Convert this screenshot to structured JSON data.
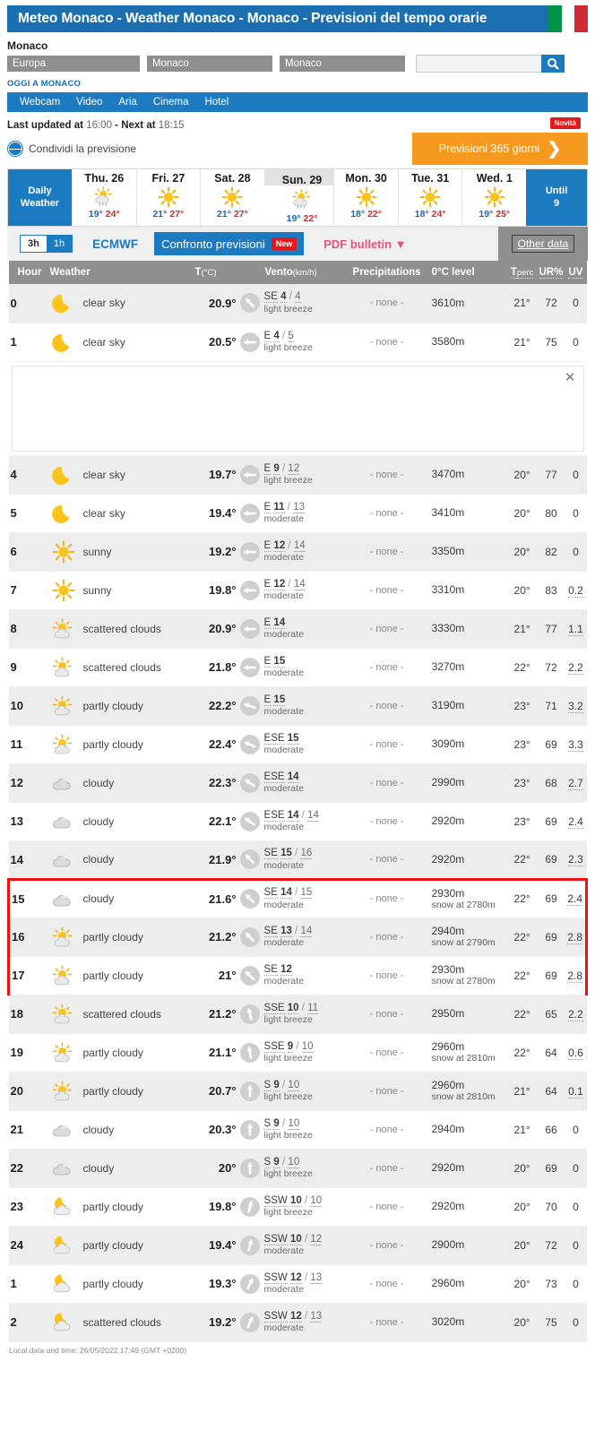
{
  "header": {
    "title": "Meteo Monaco - Weather Monaco - Monaco - Previsioni del tempo orarie",
    "flag": "italy-flag"
  },
  "location": {
    "name": "Monaco",
    "continent": "Europa",
    "country": "Monaco",
    "city": "Monaco",
    "search_value": "",
    "search_placeholder": ""
  },
  "today_label": "OGGI A MONACO",
  "nav": {
    "items": [
      "Webcam",
      "Video",
      "Aria",
      "Cinema",
      "Hotel"
    ]
  },
  "update": {
    "prefix": "Last updated at",
    "last": "16:00",
    "middle": "- Next at",
    "next": "18:15",
    "share": "Condividi la previsione"
  },
  "promo": {
    "label": "Previsioni 365 giorni",
    "badge": "Novità",
    "chevron": "❯"
  },
  "daystrip": {
    "first_label_line1": "Daily",
    "first_label_line2": "Weather",
    "last_label_line1": "Until",
    "last_label_line2": "9",
    "days": [
      {
        "name": "Thu. 26",
        "icon": "sun-cloud-rain-icon",
        "min": "19°",
        "max": "24°",
        "selected": false
      },
      {
        "name": "Fri. 27",
        "icon": "sun-icon",
        "min": "21°",
        "max": "27°",
        "selected": false
      },
      {
        "name": "Sat. 28",
        "icon": "sun-icon",
        "min": "21°",
        "max": "27°",
        "selected": false
      },
      {
        "name": "Sun. 29",
        "icon": "sun-cloud-rain-icon",
        "min": "19°",
        "max": "22°",
        "selected": true
      },
      {
        "name": "Mon. 30",
        "icon": "sun-icon",
        "min": "18°",
        "max": "22°",
        "selected": false
      },
      {
        "name": "Tue. 31",
        "icon": "sun-icon",
        "min": "18°",
        "max": "24°",
        "selected": false
      },
      {
        "name": "Wed. 1",
        "icon": "sun-icon",
        "min": "19°",
        "max": "25°",
        "selected": false
      }
    ]
  },
  "options": {
    "toggle_3h": "3h",
    "toggle_1h": "1h",
    "model": "ECMWF",
    "compare": "Confronto previsioni",
    "compare_badge": "New",
    "pdf": "PDF bulletin ▼",
    "other_data": "Other data"
  },
  "table": {
    "headers": {
      "hour": "Hour",
      "weather": "Weather",
      "t_main": "T",
      "t_sub": "(°C)",
      "wind_main": "Vento",
      "wind_sub": "(km/h)",
      "precipitations": "Precipitations",
      "zero_level": "0°C level",
      "tperc_main": "T",
      "tperc_sub": "perc",
      "ur": "UR%",
      "uv": "UV"
    },
    "rows": [
      {
        "hour": "0",
        "icon": "moon-icon",
        "weather": "clear sky",
        "temp": "20.9°",
        "wind_dir": "SE",
        "wind_speed": "4",
        "wind_gust": "4",
        "wind_desc": "light breeze",
        "wind_angle": 315,
        "prec": "- none -",
        "level": "3610m",
        "snow": "",
        "tperc": "21°",
        "ur": "72",
        "uv": "0",
        "uv_dotted": false
      },
      {
        "hour": "1",
        "icon": "moon-icon",
        "weather": "clear sky",
        "temp": "20.5°",
        "wind_dir": "E",
        "wind_speed": "4",
        "wind_gust": "5",
        "wind_desc": "light breeze",
        "wind_angle": 270,
        "prec": "- none -",
        "level": "3580m",
        "snow": "",
        "tperc": "21°",
        "ur": "75",
        "uv": "0",
        "uv_dotted": false
      },
      {
        "ad": true,
        "close": "✕"
      },
      {
        "hour": "4",
        "icon": "moon-icon",
        "weather": "clear sky",
        "temp": "19.7°",
        "wind_dir": "E",
        "wind_speed": "9",
        "wind_gust": "12",
        "wind_desc": "light breeze",
        "wind_angle": 270,
        "prec": "- none -",
        "level": "3470m",
        "snow": "",
        "tperc": "20°",
        "ur": "77",
        "uv": "0",
        "uv_dotted": false
      },
      {
        "hour": "5",
        "icon": "moon-icon",
        "weather": "clear sky",
        "temp": "19.4°",
        "wind_dir": "E",
        "wind_speed": "11",
        "wind_gust": "13",
        "wind_desc": "moderate",
        "wind_angle": 270,
        "prec": "- none -",
        "level": "3410m",
        "snow": "",
        "tperc": "20°",
        "ur": "80",
        "uv": "0",
        "uv_dotted": false
      },
      {
        "hour": "6",
        "icon": "sun-icon",
        "weather": "sunny",
        "temp": "19.2°",
        "wind_dir": "E",
        "wind_speed": "12",
        "wind_gust": "14",
        "wind_desc": "moderate",
        "wind_angle": 270,
        "prec": "- none -",
        "level": "3350m",
        "snow": "",
        "tperc": "20°",
        "ur": "82",
        "uv": "0",
        "uv_dotted": false
      },
      {
        "hour": "7",
        "icon": "sun-icon",
        "weather": "sunny",
        "temp": "19.8°",
        "wind_dir": "E",
        "wind_speed": "12",
        "wind_gust": "14",
        "wind_desc": "moderate",
        "wind_angle": 270,
        "prec": "- none -",
        "level": "3310m",
        "snow": "",
        "tperc": "20°",
        "ur": "83",
        "uv": "0.2",
        "uv_dotted": true
      },
      {
        "hour": "8",
        "icon": "sun-cloud-icon",
        "weather": "scattered clouds",
        "temp": "20.9°",
        "wind_dir": "E",
        "wind_speed": "14",
        "wind_gust": "",
        "wind_desc": "moderate",
        "wind_angle": 270,
        "prec": "- none -",
        "level": "3330m",
        "snow": "",
        "tperc": "21°",
        "ur": "77",
        "uv": "1.1",
        "uv_dotted": true
      },
      {
        "hour": "9",
        "icon": "sun-cloud-icon",
        "weather": "scattered clouds",
        "temp": "21.8°",
        "wind_dir": "E",
        "wind_speed": "15",
        "wind_gust": "",
        "wind_desc": "moderate",
        "wind_angle": 270,
        "prec": "- none -",
        "level": "3270m",
        "snow": "",
        "tperc": "22°",
        "ur": "72",
        "uv": "2.2",
        "uv_dotted": true
      },
      {
        "hour": "10",
        "icon": "sun-cloud-icon",
        "weather": "partly cloudy",
        "temp": "22.2°",
        "wind_dir": "E",
        "wind_speed": "15",
        "wind_gust": "",
        "wind_desc": "moderate",
        "wind_angle": 290,
        "prec": "- none -",
        "level": "3190m",
        "snow": "",
        "tperc": "23°",
        "ur": "71",
        "uv": "3.2",
        "uv_dotted": true
      },
      {
        "hour": "11",
        "icon": "sun-cloud-icon",
        "weather": "partly cloudy",
        "temp": "22.4°",
        "wind_dir": "ESE",
        "wind_speed": "15",
        "wind_gust": "",
        "wind_desc": "moderate",
        "wind_angle": 295,
        "prec": "- none -",
        "level": "3090m",
        "snow": "",
        "tperc": "23°",
        "ur": "69",
        "uv": "3.3",
        "uv_dotted": true
      },
      {
        "hour": "12",
        "icon": "cloud-icon",
        "weather": "cloudy",
        "temp": "22.3°",
        "wind_dir": "ESE",
        "wind_speed": "14",
        "wind_gust": "",
        "wind_desc": "moderate",
        "wind_angle": 305,
        "prec": "- none -",
        "level": "2990m",
        "snow": "",
        "tperc": "23°",
        "ur": "68",
        "uv": "2.7",
        "uv_dotted": true
      },
      {
        "hour": "13",
        "icon": "cloud-icon",
        "weather": "cloudy",
        "temp": "22.1°",
        "wind_dir": "ESE",
        "wind_speed": "14",
        "wind_gust": "14",
        "wind_desc": "moderate",
        "wind_angle": 305,
        "prec": "- none -",
        "level": "2920m",
        "snow": "",
        "tperc": "23°",
        "ur": "69",
        "uv": "2.4",
        "uv_dotted": true
      },
      {
        "hour": "14",
        "icon": "cloud-icon",
        "weather": "cloudy",
        "temp": "21.9°",
        "wind_dir": "SE",
        "wind_speed": "15",
        "wind_gust": "16",
        "wind_desc": "moderate",
        "wind_angle": 315,
        "prec": "- none -",
        "level": "2920m",
        "snow": "",
        "tperc": "22°",
        "ur": "69",
        "uv": "2.3",
        "uv_dotted": true
      },
      {
        "hour": "15",
        "icon": "cloud-icon",
        "weather": "cloudy",
        "temp": "21.6°",
        "wind_dir": "SE",
        "wind_speed": "14",
        "wind_gust": "15",
        "wind_desc": "moderate",
        "wind_angle": 315,
        "prec": "- none -",
        "level": "2930m",
        "snow": "snow at 2780m",
        "tperc": "22°",
        "ur": "69",
        "uv": "2.4",
        "uv_dotted": true,
        "highlight": "top"
      },
      {
        "hour": "16",
        "icon": "sun-cloud-icon",
        "weather": "partly cloudy",
        "temp": "21.2°",
        "wind_dir": "SE",
        "wind_speed": "13",
        "wind_gust": "14",
        "wind_desc": "moderate",
        "wind_angle": 315,
        "prec": "- none -",
        "level": "2940m",
        "snow": "snow at 2790m",
        "tperc": "22°",
        "ur": "69",
        "uv": "2.8",
        "uv_dotted": true,
        "highlight": "mid"
      },
      {
        "hour": "17",
        "icon": "sun-cloud-icon",
        "weather": "partly cloudy",
        "temp": "21°",
        "wind_dir": "SE",
        "wind_speed": "12",
        "wind_gust": "",
        "wind_desc": "moderate",
        "wind_angle": 315,
        "prec": "- none -",
        "level": "2930m",
        "snow": "snow at 2780m",
        "tperc": "22°",
        "ur": "69",
        "uv": "2.8",
        "uv_dotted": true,
        "highlight": "bot"
      },
      {
        "hour": "18",
        "icon": "sun-cloud-icon",
        "weather": "scattered clouds",
        "temp": "21.2°",
        "wind_dir": "SSE",
        "wind_speed": "10",
        "wind_gust": "11",
        "wind_desc": "light breeze",
        "wind_angle": 345,
        "prec": "- none -",
        "level": "2950m",
        "snow": "",
        "tperc": "22°",
        "ur": "65",
        "uv": "2.2",
        "uv_dotted": true
      },
      {
        "hour": "19",
        "icon": "sun-cloud-icon",
        "weather": "partly cloudy",
        "temp": "21.1°",
        "wind_dir": "SSE",
        "wind_speed": "9",
        "wind_gust": "10",
        "wind_desc": "light breeze",
        "wind_angle": 350,
        "prec": "- none -",
        "level": "2960m",
        "snow": "snow at 2810m",
        "tperc": "22°",
        "ur": "64",
        "uv": "0.6",
        "uv_dotted": true
      },
      {
        "hour": "20",
        "icon": "sun-cloud-icon",
        "weather": "partly cloudy",
        "temp": "20.7°",
        "wind_dir": "S",
        "wind_speed": "9",
        "wind_gust": "10",
        "wind_desc": "light breeze",
        "wind_angle": 0,
        "prec": "- none -",
        "level": "2960m",
        "snow": "snow at 2810m",
        "tperc": "21°",
        "ur": "64",
        "uv": "0.1",
        "uv_dotted": true
      },
      {
        "hour": "21",
        "icon": "cloud-icon",
        "weather": "cloudy",
        "temp": "20.3°",
        "wind_dir": "S",
        "wind_speed": "9",
        "wind_gust": "10",
        "wind_desc": "light breeze",
        "wind_angle": 0,
        "prec": "- none -",
        "level": "2940m",
        "snow": "",
        "tperc": "21°",
        "ur": "66",
        "uv": "0",
        "uv_dotted": false
      },
      {
        "hour": "22",
        "icon": "cloud-icon",
        "weather": "cloudy",
        "temp": "20°",
        "wind_dir": "S",
        "wind_speed": "9",
        "wind_gust": "10",
        "wind_desc": "light breeze",
        "wind_angle": 0,
        "prec": "- none -",
        "level": "2920m",
        "snow": "",
        "tperc": "20°",
        "ur": "69",
        "uv": "0",
        "uv_dotted": false
      },
      {
        "hour": "23",
        "icon": "moon-cloud-icon",
        "weather": "partly cloudy",
        "temp": "19.8°",
        "wind_dir": "SSW",
        "wind_speed": "10",
        "wind_gust": "10",
        "wind_desc": "light breeze",
        "wind_angle": 15,
        "prec": "- none -",
        "level": "2920m",
        "snow": "",
        "tperc": "20°",
        "ur": "70",
        "uv": "0",
        "uv_dotted": false
      },
      {
        "hour": "24",
        "icon": "moon-cloud-icon",
        "weather": "partly cloudy",
        "temp": "19.4°",
        "wind_dir": "SSW",
        "wind_speed": "10",
        "wind_gust": "12",
        "wind_desc": "moderate",
        "wind_angle": 15,
        "prec": "- none -",
        "level": "2900m",
        "snow": "",
        "tperc": "20°",
        "ur": "72",
        "uv": "0",
        "uv_dotted": false
      },
      {
        "hour": "1",
        "icon": "moon-cloud-icon",
        "weather": "partly cloudy",
        "temp": "19.3°",
        "wind_dir": "SSW",
        "wind_speed": "12",
        "wind_gust": "13",
        "wind_desc": "moderate",
        "wind_angle": 25,
        "prec": "- none -",
        "level": "2960m",
        "snow": "",
        "tperc": "20°",
        "ur": "73",
        "uv": "0",
        "uv_dotted": false
      },
      {
        "hour": "2",
        "icon": "moon-cloud-icon",
        "weather": "scattered clouds",
        "temp": "19.2°",
        "wind_dir": "SSW",
        "wind_speed": "12",
        "wind_gust": "13",
        "wind_desc": "moderate",
        "wind_angle": 25,
        "prec": "- none -",
        "level": "3020m",
        "snow": "",
        "tperc": "20°",
        "ur": "75",
        "uv": "0",
        "uv_dotted": false
      }
    ]
  },
  "footer": {
    "local_time": "Local data and time: 26/05/2022 17:49 (GMT +0200)"
  },
  "colors": {
    "brand_blue": "#1b7ac0",
    "title_blue": "#1b6fb0",
    "orange": "#f59a1e",
    "red": "#e3181b",
    "highlight_red": "#ee1111",
    "grey_header": "#8f8f8f"
  }
}
